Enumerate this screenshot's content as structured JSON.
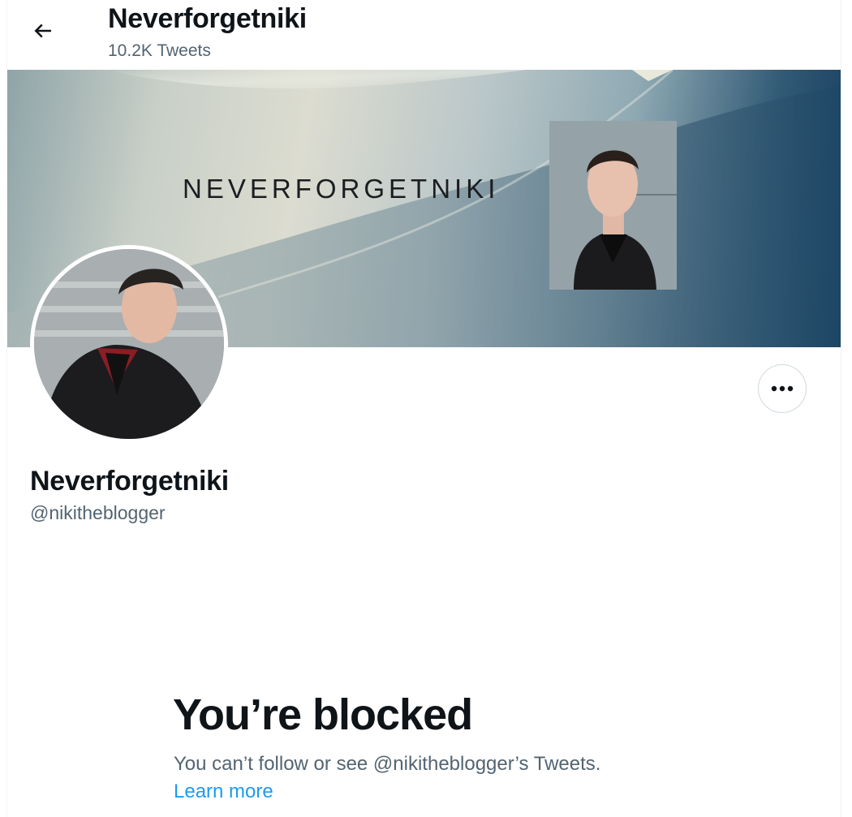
{
  "header": {
    "title": "Neverforgetniki",
    "tweet_count": "10.2K Tweets",
    "back_icon": "arrow-left-icon"
  },
  "banner": {
    "text": "NEVERFORGETNIKI"
  },
  "profile": {
    "name": "Neverforgetniki",
    "handle": "@nikitheblogger",
    "more_icon": "more-horizontal-icon"
  },
  "blocked": {
    "title": "You’re blocked",
    "description": "You can’t follow or see @nikitheblogger’s Tweets.",
    "link": "Learn more"
  },
  "colors": {
    "text_primary": "#0f1419",
    "text_secondary": "#536471",
    "link": "#1d9bf0",
    "border": "#cfd9de"
  }
}
